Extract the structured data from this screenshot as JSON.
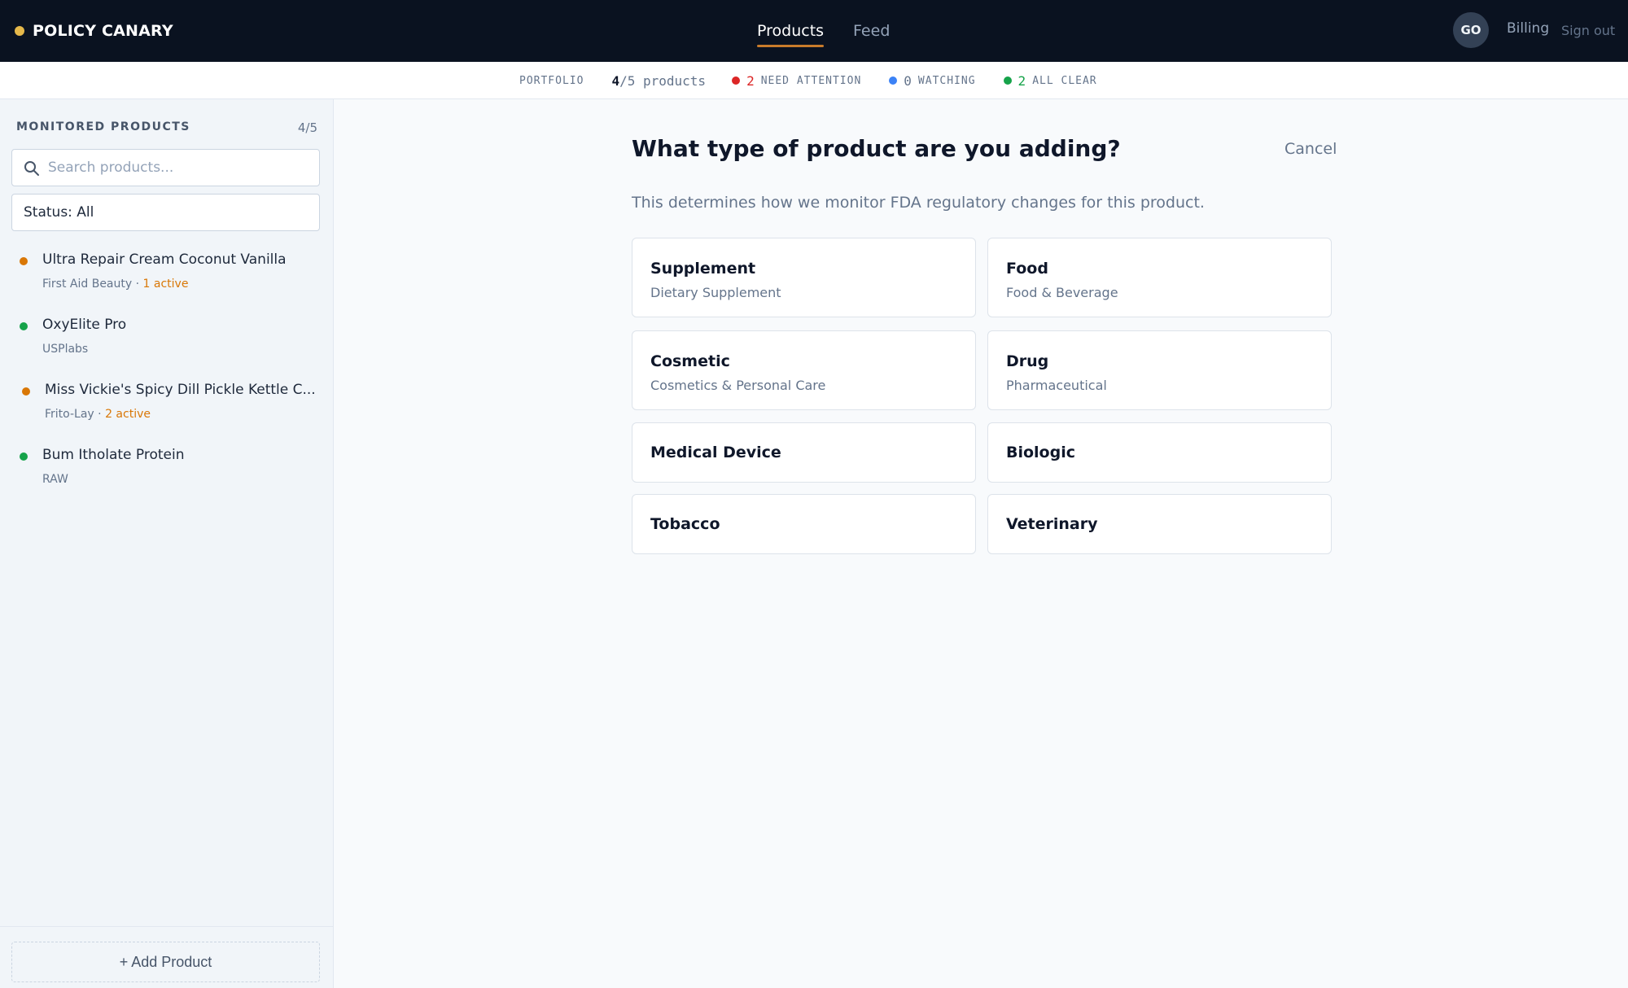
{
  "app": {
    "brand": "POLICY CANARY",
    "colors": {
      "brand_dot": "#e5b84a",
      "nav_underline": "#c97b2b",
      "attention": "#dc2626",
      "watching": "#3b82f6",
      "clear": "#16a34a",
      "warning": "#d97706"
    }
  },
  "nav": {
    "items": [
      {
        "label": "Products",
        "active": true
      },
      {
        "label": "Feed",
        "active": false
      }
    ],
    "avatar_initials": "GO",
    "billing_label": "Billing",
    "signout_label": "Sign out"
  },
  "portfolio": {
    "label": "PORTFOLIO",
    "current": "4",
    "total_suffix": "/5 products",
    "stats": [
      {
        "count": "2",
        "label": "NEED ATTENTION",
        "color": "#dc2626"
      },
      {
        "count": "0",
        "label": "WATCHING",
        "color": "#3b82f6"
      },
      {
        "count": "2",
        "label": "ALL CLEAR",
        "color": "#16a34a"
      }
    ]
  },
  "sidebar": {
    "title": "MONITORED PRODUCTS",
    "count": "4/5",
    "search_placeholder": "Search products...",
    "search_icon": "search-icon",
    "status_filter": "Status: All",
    "products": [
      {
        "name": "Ultra Repair Cream Coconut Vanilla",
        "brand": "First Aid Beauty",
        "sep": " · ",
        "active": "1 active",
        "status": "attention",
        "dot_color": "#d97706"
      },
      {
        "name": "OxyElite Pro",
        "brand": "USPlabs",
        "sep": "",
        "active": "",
        "status": "clear",
        "dot_color": "#16a34a"
      },
      {
        "name": "Miss Vickie's Spicy Dill Pickle Kettle C...",
        "brand": "Frito-Lay",
        "sep": " · ",
        "active": "2 active",
        "status": "attention",
        "dot_color": "#d97706"
      },
      {
        "name": "Bum Itholate Protein",
        "brand": "RAW",
        "sep": "",
        "active": "",
        "status": "clear",
        "dot_color": "#16a34a"
      }
    ],
    "add_button": "+ Add Product"
  },
  "main": {
    "title": "What type of product are you adding?",
    "cancel_label": "Cancel",
    "subtitle": "This determines how we monitor FDA regulatory changes for this product.",
    "types": [
      {
        "title": "Supplement",
        "subtitle": "Dietary Supplement"
      },
      {
        "title": "Food",
        "subtitle": "Food & Beverage"
      },
      {
        "title": "Cosmetic",
        "subtitle": "Cosmetics & Personal Care"
      },
      {
        "title": "Drug",
        "subtitle": "Pharmaceutical"
      },
      {
        "title": "Medical Device",
        "subtitle": ""
      },
      {
        "title": "Biologic",
        "subtitle": ""
      },
      {
        "title": "Tobacco",
        "subtitle": ""
      },
      {
        "title": "Veterinary",
        "subtitle": ""
      }
    ]
  }
}
